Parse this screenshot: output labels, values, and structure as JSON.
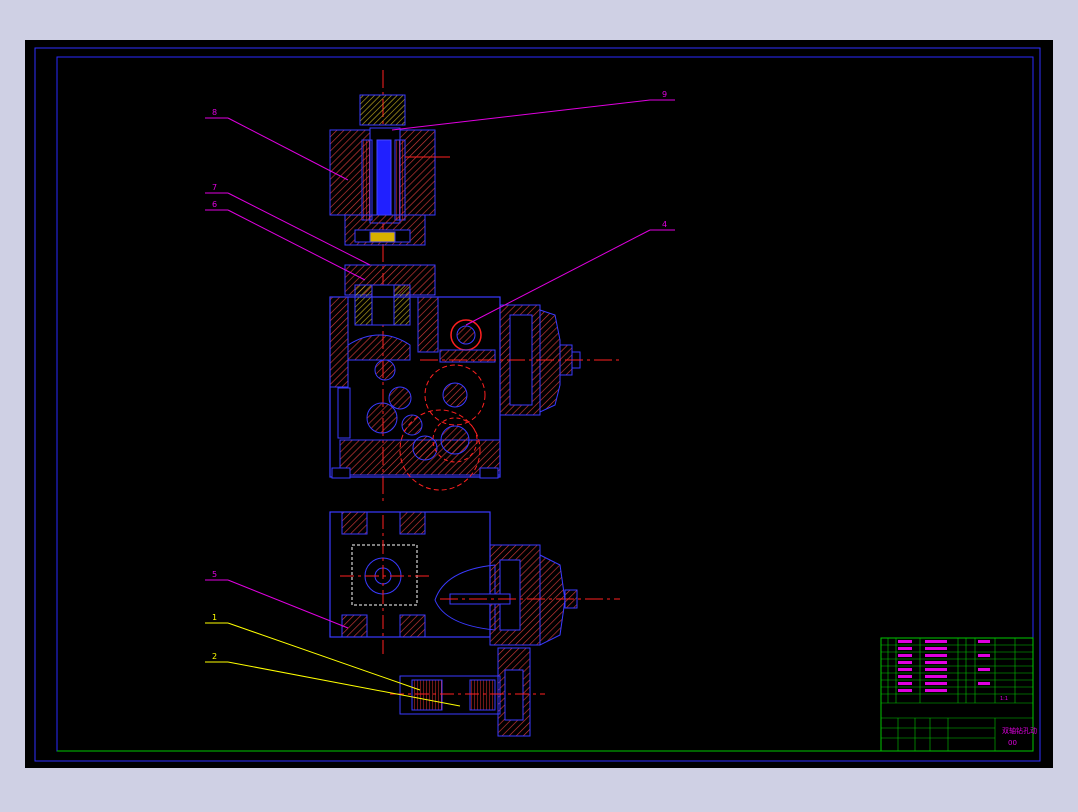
{
  "drawing": {
    "callouts": [
      {
        "id": "callout-8-top",
        "label": "8",
        "color": "#e000e0"
      },
      {
        "id": "callout-9",
        "label": "9",
        "color": "#e000e0"
      },
      {
        "id": "callout-7",
        "label": "7",
        "color": "#e000e0"
      },
      {
        "id": "callout-6",
        "label": "6",
        "color": "#e000e0"
      },
      {
        "id": "callout-4",
        "label": "4",
        "color": "#e000e0"
      },
      {
        "id": "callout-5",
        "label": "5",
        "color": "#e000e0"
      },
      {
        "id": "callout-1",
        "label": "1",
        "color": "#ffff00"
      },
      {
        "id": "callout-2",
        "label": "2",
        "color": "#ffff00"
      }
    ],
    "title_block": {
      "drawing_title": "双轴钻孔动",
      "drawing_no": "00",
      "scale_label": "1:1"
    }
  },
  "colors": {
    "canvas_bg": "#000000",
    "outer_bg": "#cfd0e4",
    "frame": "#3030ff",
    "inner_border": "#00c800",
    "outline": "#3a3aff",
    "hatch": "#d03a3a",
    "centerline": "#ff2020",
    "leader_magenta": "#e000e0",
    "leader_yellow": "#ffff00",
    "title_block_line": "#00c800",
    "title_text": "#e000e0"
  }
}
